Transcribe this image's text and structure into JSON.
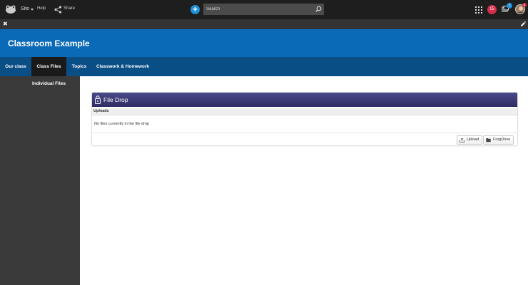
{
  "topbar": {
    "site_label": "Site",
    "help_label": "Help",
    "share_label": "Share",
    "add_label": "+",
    "search_placeholder": "Search",
    "notifications_count": "15",
    "messages_count": "1",
    "avatar_badge": "6"
  },
  "subbar": {
    "close_symbol": "✖"
  },
  "banner": {
    "title": "Classroom Example"
  },
  "nav": {
    "tabs": [
      {
        "label": "Our class",
        "active": false
      },
      {
        "label": "Class Files",
        "active": true
      },
      {
        "label": "Topics",
        "active": false
      },
      {
        "label": "Classwork & Homework",
        "active": false
      }
    ]
  },
  "sidebar": {
    "items": [
      {
        "label": "Individual Files"
      }
    ]
  },
  "file_drop": {
    "title": "File Drop",
    "section_label": "Uploads",
    "empty_message": "No files currently in the file drop",
    "upload_label": "Upload",
    "frogdrive_label": "FrogDrive"
  },
  "colors": {
    "banner": "#0b6ab7",
    "nav": "#0a4e86",
    "topbar": "#1e1e1e",
    "card_header": "#3c3b77",
    "notification_badge": "#d62d4a",
    "accent": "#1e8fd8"
  },
  "icons": [
    "frog-logo-icon",
    "share-icon",
    "add-icon",
    "search-icon",
    "apps-grid-icon",
    "messages-icon",
    "close-icon",
    "edit-icon",
    "lock-icon",
    "upload-icon",
    "folder-icon"
  ]
}
